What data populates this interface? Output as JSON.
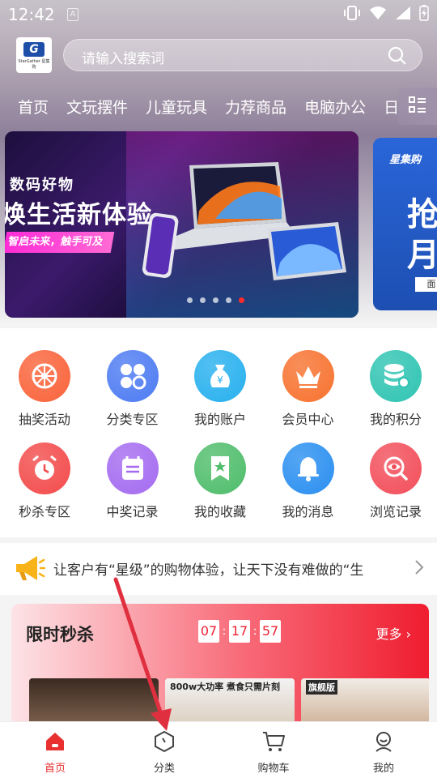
{
  "status_bar": {
    "time": "12:42",
    "indicator": "A"
  },
  "header": {
    "logo_text": "G",
    "logo_sub": "StarGather 星集购",
    "search_placeholder": "请输入搜索词"
  },
  "category_nav": {
    "items": [
      "首页",
      "文玩摆件",
      "儿童玩具",
      "力荐商品",
      "电脑办公",
      "日"
    ]
  },
  "banner": {
    "title": "数码好物",
    "headline": "焕生活新体验",
    "tag": "智启未来，触手可及",
    "dot_count": 5,
    "active_dot": 4
  },
  "banner_next": {
    "brand": "星集购",
    "big": "抢\n月",
    "pill": "面"
  },
  "quick_grid": [
    {
      "label": "抽奖活动",
      "icon": "wheel-icon",
      "color": "#f9633a"
    },
    {
      "label": "分类专区",
      "icon": "category-icon",
      "color": "#4d7bf2"
    },
    {
      "label": "我的账户",
      "icon": "money-bag-icon",
      "color": "#27b0ee"
    },
    {
      "label": "会员中心",
      "icon": "crown-icon",
      "color": "#f7722f"
    },
    {
      "label": "我的积分",
      "icon": "coins-icon",
      "color": "#2fc4b2"
    },
    {
      "label": "秒杀专区",
      "icon": "alarm-clock-icon",
      "color": "#f34b4b"
    },
    {
      "label": "中奖记录",
      "icon": "calendar-icon",
      "color": "#a46bf0"
    },
    {
      "label": "我的收藏",
      "icon": "bookmark-star-icon",
      "color": "#4fbd6b"
    },
    {
      "label": "我的消息",
      "icon": "bell-icon",
      "color": "#2a8ff0"
    },
    {
      "label": "浏览记录",
      "icon": "eye-search-icon",
      "color": "#f24e5a"
    }
  ],
  "notice": {
    "text": "让客户有“星级”的购物体验，让天下没有难做的“生"
  },
  "flash_sale": {
    "title": "限时秒杀",
    "hours": "07",
    "minutes": "17",
    "seconds": "57",
    "more_label": "更多",
    "products": [
      {
        "caption": ""
      },
      {
        "caption": "800w大功率  煮食只需片刻"
      },
      {
        "caption": "旗舰版"
      }
    ]
  },
  "tab_bar": {
    "tabs": [
      {
        "label": "首页",
        "icon": "home-icon",
        "active": true
      },
      {
        "label": "分类",
        "icon": "category-hex-icon",
        "active": false
      },
      {
        "label": "购物车",
        "icon": "cart-icon",
        "active": false
      },
      {
        "label": "我的",
        "icon": "profile-icon",
        "active": false
      }
    ]
  },
  "colors": {
    "accent": "#e83030",
    "banner_dot_active": "#ff2a2a"
  }
}
